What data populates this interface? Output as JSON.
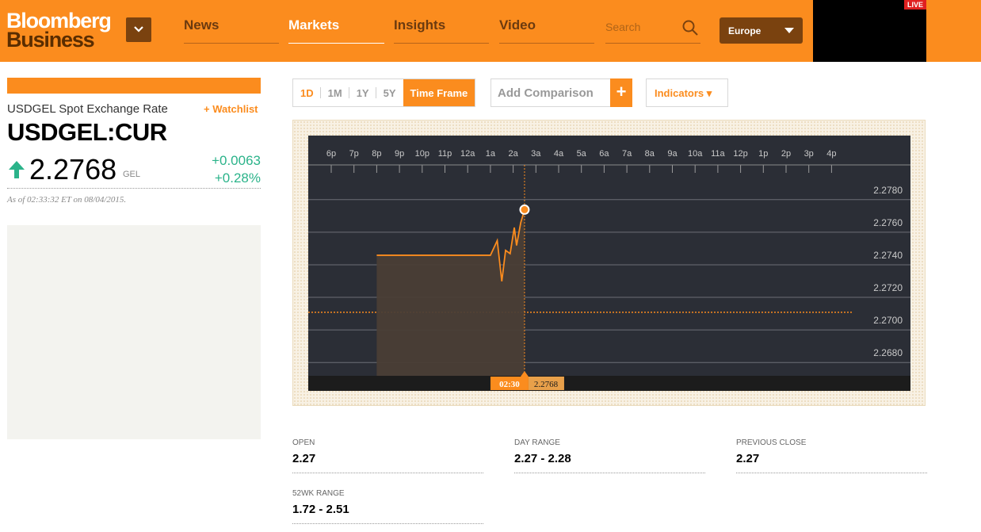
{
  "brand": {
    "line1": "Bloomberg",
    "line2": "Business"
  },
  "nav": {
    "items": [
      {
        "label": "News",
        "active": false
      },
      {
        "label": "Markets",
        "active": true
      },
      {
        "label": "Insights",
        "active": false
      },
      {
        "label": "Video",
        "active": false
      }
    ],
    "search_placeholder": "Search",
    "region": "Europe",
    "live_label": "LIVE"
  },
  "quote": {
    "name": "USDGEL Spot Exchange Rate",
    "watchlist_label": "+ Watchlist",
    "ticker": "USDGEL:CUR",
    "price": "2.2768",
    "currency": "GEL",
    "change": "+0.0063",
    "change_pct": "+0.28%",
    "as_of": "As of 02:33:32 ET on 08/04/2015."
  },
  "toolbar": {
    "timeframes": [
      "1D",
      "1M",
      "1Y",
      "5Y"
    ],
    "timeframe_label": "Time Frame",
    "comparison_placeholder": "Add Comparison",
    "comparison_plus": "+",
    "indicators_label": "Indicators ▾"
  },
  "colors": {
    "accent": "#fb8c1e",
    "chart_bg": "#2b2e36",
    "up": "#2bb38a"
  },
  "chart_data": {
    "type": "line",
    "x_ticks": [
      "6p",
      "7p",
      "8p",
      "9p",
      "10p",
      "11p",
      "12a",
      "1a",
      "2a",
      "3a",
      "4a",
      "5a",
      "6a",
      "7a",
      "8a",
      "9a",
      "10a",
      "11a",
      "12p",
      "1p",
      "2p",
      "3p",
      "4p"
    ],
    "y_ticks": [
      "2.2780",
      "2.2760",
      "2.2740",
      "2.2720",
      "2.2700",
      "2.2680"
    ],
    "ylim": [
      2.2666,
      2.2794
    ],
    "previous_close": 2.2705,
    "series": [
      {
        "points": [
          [
            "8p",
            2.274
          ],
          [
            "1a",
            2.274
          ],
          [
            "1:18a",
            2.2749
          ],
          [
            "1:30a",
            2.2724
          ],
          [
            "1:40a",
            2.2743
          ],
          [
            "1:52a",
            2.2741
          ],
          [
            "2:03a",
            2.2757
          ],
          [
            "2:09a",
            2.2746
          ],
          [
            "2:20a",
            2.276
          ],
          [
            "2:30a",
            2.2768
          ]
        ]
      }
    ],
    "cursor": {
      "time": "02:30",
      "value": "2.2768"
    }
  },
  "stats": [
    {
      "label": "OPEN",
      "value": "2.27"
    },
    {
      "label": "DAY RANGE",
      "value": "2.27 - 2.28"
    },
    {
      "label": "PREVIOUS CLOSE",
      "value": "2.27"
    },
    {
      "label": "52WK RANGE",
      "value": "1.72 - 2.51"
    }
  ]
}
